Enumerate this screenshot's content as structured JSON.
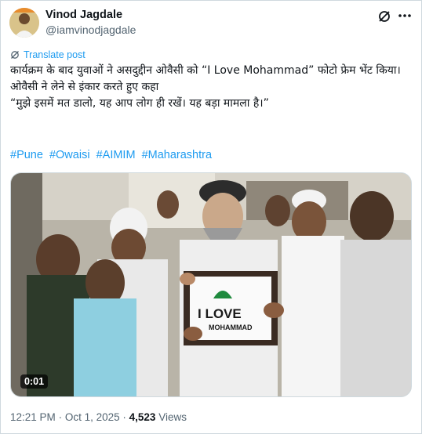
{
  "author": {
    "name": "Vinod Jagdale",
    "handle": "@iamvinodjagdale"
  },
  "icons": {
    "grok": "grok-icon",
    "more": "more-icon",
    "translate": "translate-icon"
  },
  "translate_label": "Translate post",
  "post_lines": [
    "कार्यक्रम के बाद युवाओं ने असदुद्दीन ओवैसी को “I Love Mohammad” फोटो फ्रेम भेंट किया।",
    "ओवैसी ने लेने से इंकार करते हुए कहा",
    "“मुझे इसमें मत डालो, यह आप लोग ही रखें। यह बड़ा मामला है।”"
  ],
  "hashtags": [
    "#Pune",
    "#Owaisi",
    "#AIMIM",
    "#Maharashtra"
  ],
  "video": {
    "duration": "0:01",
    "frame_text_line1": "I LOVE",
    "frame_text_line2": "MOHAMMAD"
  },
  "meta": {
    "time": "12:21 PM",
    "date": "Oct 1, 2025",
    "separator": "·",
    "views_count": "4,523",
    "views_label": "Views"
  },
  "colors": {
    "accent": "#1d9bf0",
    "secondary_text": "#536471",
    "border": "#cfd9de"
  }
}
